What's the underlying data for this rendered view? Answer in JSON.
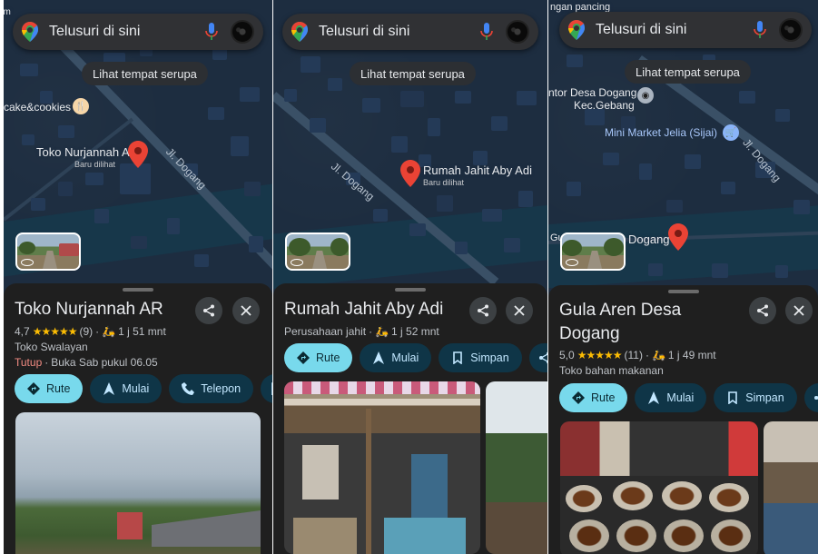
{
  "search": {
    "placeholder": "Telusuri di sini"
  },
  "similar_chip": "Lihat tempat serupa",
  "panels": [
    {
      "map": {
        "pin_label": "Toko Nurjannah AR",
        "pin_sub": "Baru dilihat",
        "road_label": "Jl. Dogang",
        "poi_label": "cake&cookies",
        "edge_label": "am"
      },
      "place": {
        "title": "Toko Nurjannah AR",
        "rating": "4,7",
        "stars": "★★★★★",
        "reviews": "(9)",
        "travel": "1 j 51 mnt",
        "category": "Toko Swalayan",
        "status": "Tutup",
        "status_detail": "Buka Sab pukul 06.05"
      },
      "buttons": {
        "route": "Rute",
        "start": "Mulai",
        "call": "Telepon"
      }
    },
    {
      "map": {
        "pin_label": "Rumah Jahit Aby Adi",
        "pin_sub": "Baru dilihat",
        "road_label": "Jl. Dogang"
      },
      "place": {
        "title": "Rumah Jahit Aby Adi",
        "category": "Perusahaan jahit",
        "travel": "1 j 52 mnt"
      },
      "buttons": {
        "route": "Rute",
        "start": "Mulai",
        "save": "Simpan"
      }
    },
    {
      "map": {
        "top_label": "ngan pancing",
        "poi1_line1": "ntor Desa Dogang",
        "poi1_line2": "Kec.Gebang",
        "poi2_label": "Mini Market Jelia (Sijai)",
        "road_label": "Jl. Dogang",
        "pin_label": "Dogang",
        "edge_label": "Gu"
      },
      "place": {
        "title_line1": "Gula Aren Desa",
        "title_line2": "Dogang",
        "rating": "5,0",
        "stars": "★★★★★",
        "reviews": "(11)",
        "travel": "1 j 49 mnt",
        "category": "Toko bahan makanan"
      },
      "buttons": {
        "route": "Rute",
        "start": "Mulai",
        "save": "Simpan"
      }
    }
  ],
  "colors": {
    "map_bg": "#1d2d40",
    "building": "#243a57",
    "sheet_bg": "#1f1f1f",
    "primary_btn": "#78d9ec",
    "secondary_btn": "#0f3547",
    "pin": "#ea4335",
    "stars": "#fbbc04",
    "closed": "#f28b82"
  },
  "icons": [
    "google-maps-logo-icon",
    "mic-icon",
    "avatar",
    "map-pin-icon",
    "share-icon",
    "close-icon",
    "directions-icon",
    "navigation-arrow-icon",
    "phone-icon",
    "bookmark-icon",
    "motorcycle-icon",
    "street-view-360-icon",
    "restaurant-icon",
    "shopping-cart-icon",
    "government-building-icon"
  ]
}
